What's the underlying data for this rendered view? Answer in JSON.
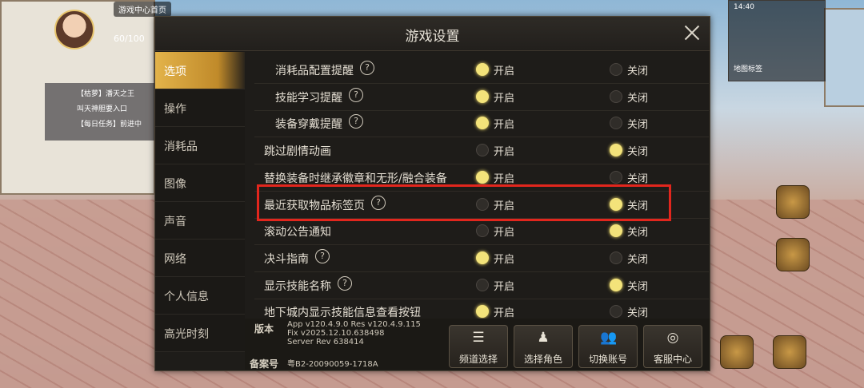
{
  "hud": {
    "news_title": "游戏中心首页",
    "hp": "60/100",
    "quest_lines": [
      "【枯萝】潘天之王",
      "叫天神胆要入口",
      "【每日任务】前进中"
    ],
    "minimap_status": "14:40",
    "minimap_label": "地图标签"
  },
  "dialog": {
    "title": "游戏设置",
    "tabs": [
      {
        "label": "选项",
        "active": true
      },
      {
        "label": "操作",
        "active": false
      },
      {
        "label": "消耗品",
        "active": false
      },
      {
        "label": "图像",
        "active": false
      },
      {
        "label": "声音",
        "active": false
      },
      {
        "label": "网络",
        "active": false
      },
      {
        "label": "个人信息",
        "active": false
      },
      {
        "label": "高光时刻",
        "active": false
      }
    ],
    "on_label": "开启",
    "off_label": "关闭",
    "settings": [
      {
        "label": "消耗品配置提醒",
        "help": true,
        "indent": true,
        "value": "on"
      },
      {
        "label": "技能学习提醒",
        "help": true,
        "indent": true,
        "value": "on"
      },
      {
        "label": "装备穿戴提醒",
        "help": true,
        "indent": true,
        "value": "on"
      },
      {
        "label": "跳过剧情动画",
        "help": false,
        "indent": false,
        "value": "off"
      },
      {
        "label": "替换装备时继承徽章和无形/融合装备",
        "help": false,
        "indent": false,
        "value": "on"
      },
      {
        "label": "最近获取物品标签页",
        "help": true,
        "indent": false,
        "value": "off",
        "highlighted": true
      },
      {
        "label": "滚动公告通知",
        "help": false,
        "indent": false,
        "value": "off"
      },
      {
        "label": "决斗指南",
        "help": true,
        "indent": false,
        "value": "on"
      },
      {
        "label": "显示技能名称",
        "help": true,
        "indent": false,
        "value": "off"
      },
      {
        "label": "地下城内显示技能信息查看按钮",
        "help": false,
        "indent": false,
        "value": "on"
      }
    ],
    "footer": {
      "version_label": "版本",
      "version_text": "App v120.4.9.0 Res v120.4.9.115\nFix v2025.12.10.638498\nServer Rev 638414",
      "record_label": "备案号",
      "record_text": "粤B2-20090059-1718A",
      "buttons": [
        {
          "label": "频道选择",
          "icon": "list-icon"
        },
        {
          "label": "选择角色",
          "icon": "character-icon"
        },
        {
          "label": "切换账号",
          "icon": "users-icon"
        },
        {
          "label": "客服中心",
          "icon": "support-icon"
        }
      ]
    }
  },
  "colors": {
    "active_tab": "#e3b34a",
    "toggle_on": "#f3e37a",
    "highlight_border": "#e2261d"
  }
}
